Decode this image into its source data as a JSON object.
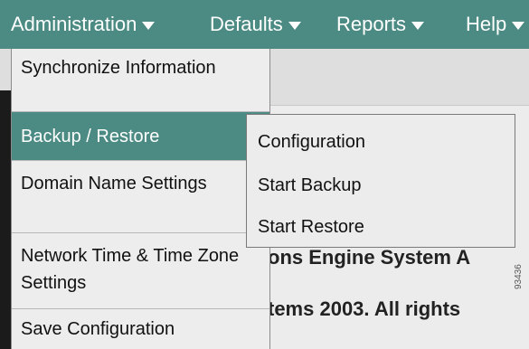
{
  "menubar": {
    "items": [
      {
        "label": "Administration"
      },
      {
        "label": "Defaults"
      },
      {
        "label": "Reports"
      },
      {
        "label": "Help"
      }
    ]
  },
  "dropdown": {
    "items": [
      {
        "label": "Synchronize Information"
      },
      {
        "label": "Backup / Restore",
        "active": true
      },
      {
        "label": "Domain Name Settings"
      },
      {
        "label": "Network Time & Time Zone Settings"
      },
      {
        "label": "Save Configuration"
      }
    ]
  },
  "submenu": {
    "items": [
      {
        "label": "Configuration"
      },
      {
        "label": "Start Backup"
      },
      {
        "label": "Start Restore"
      }
    ]
  },
  "background": {
    "line1": "ons Engine System A",
    "line2": "tems 2003. All rights",
    "side_code": "93436"
  },
  "colors": {
    "menubar": "#4b8b83",
    "active_item": "#4b8b83",
    "panel": "#ededed"
  }
}
